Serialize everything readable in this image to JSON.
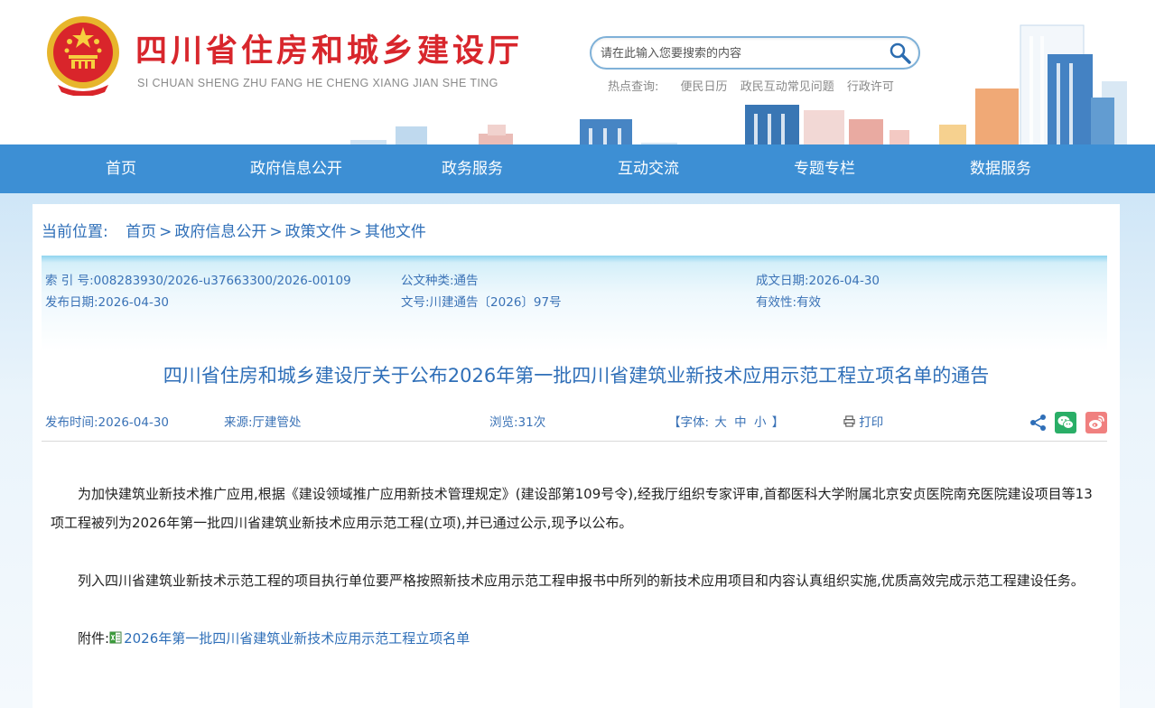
{
  "header": {
    "site_title": "四川省住房和城乡建设厅",
    "site_pinyin": "SI CHUAN SHENG ZHU FANG HE CHENG XIANG JIAN SHE TING",
    "search": {
      "placeholder": "请在此输入您要搜索的内容"
    },
    "hot": {
      "label": "热点查询:",
      "links": [
        "便民日历",
        "政民互动常见问题",
        "行政许可"
      ]
    }
  },
  "nav": {
    "items": [
      "首页",
      "政府信息公开",
      "政务服务",
      "互动交流",
      "专题专栏",
      "数据服务"
    ]
  },
  "breadcrumb": {
    "label": "当前位置:",
    "items": [
      "首页",
      "政府信息公开",
      "政策文件",
      "其他文件"
    ],
    "sep": ">"
  },
  "meta": {
    "index_no": "索 引 号:008283930/2026-u37663300/2026-00109",
    "doc_type": "公文种类:通告",
    "created_date": "成文日期:2026-04-30",
    "publish_date": "发布日期:2026-04-30",
    "doc_no": "文号:川建通告〔2026〕97号",
    "validity": "有效性:有效"
  },
  "article": {
    "title": "四川省住房和城乡建设厅关于公布2026年第一批四川省建筑业新技术应用示范工程立项名单的通告",
    "publish_time": "发布时间:2026-04-30",
    "source": "来源:厅建管处",
    "views": "浏览:31次",
    "font_label_open": "【字体:",
    "font_large": "大",
    "font_medium": "中",
    "font_small": "小",
    "font_label_close": "】",
    "print": "打印",
    "paragraph1": "为加快建筑业新技术推广应用,根据《建设领域推广应用新技术管理规定》(建设部第109号令),经我厅组织专家评审,首都医科大学附属北京安贞医院南充医院建设项目等13项工程被列为2026年第一批四川省建筑业新技术应用示范工程(立项),并已通过公示,现予以公布。",
    "paragraph2": "列入四川省建筑业新技术示范工程的项目执行单位要严格按照新技术应用示范工程申报书中所列的新技术应用项目和内容认真组织实施,优质高效完成示范工程建设任务。",
    "attachment_label": "附件:",
    "attachment_link": "2026年第一批四川省建筑业新技术应用示范工程立项名单"
  },
  "icons": {
    "search": "search-icon",
    "print": "printer-icon",
    "share": "share-icon",
    "wechat": "wechat-icon",
    "weibo": "weibo-icon",
    "attachment": "excel-file-icon"
  },
  "colors": {
    "brand_red": "#d8262c",
    "nav_blue": "#3d8fd4",
    "link_blue": "#2f6fb8",
    "wechat_green": "#2aae67",
    "weibo_pink": "#f0807f"
  }
}
